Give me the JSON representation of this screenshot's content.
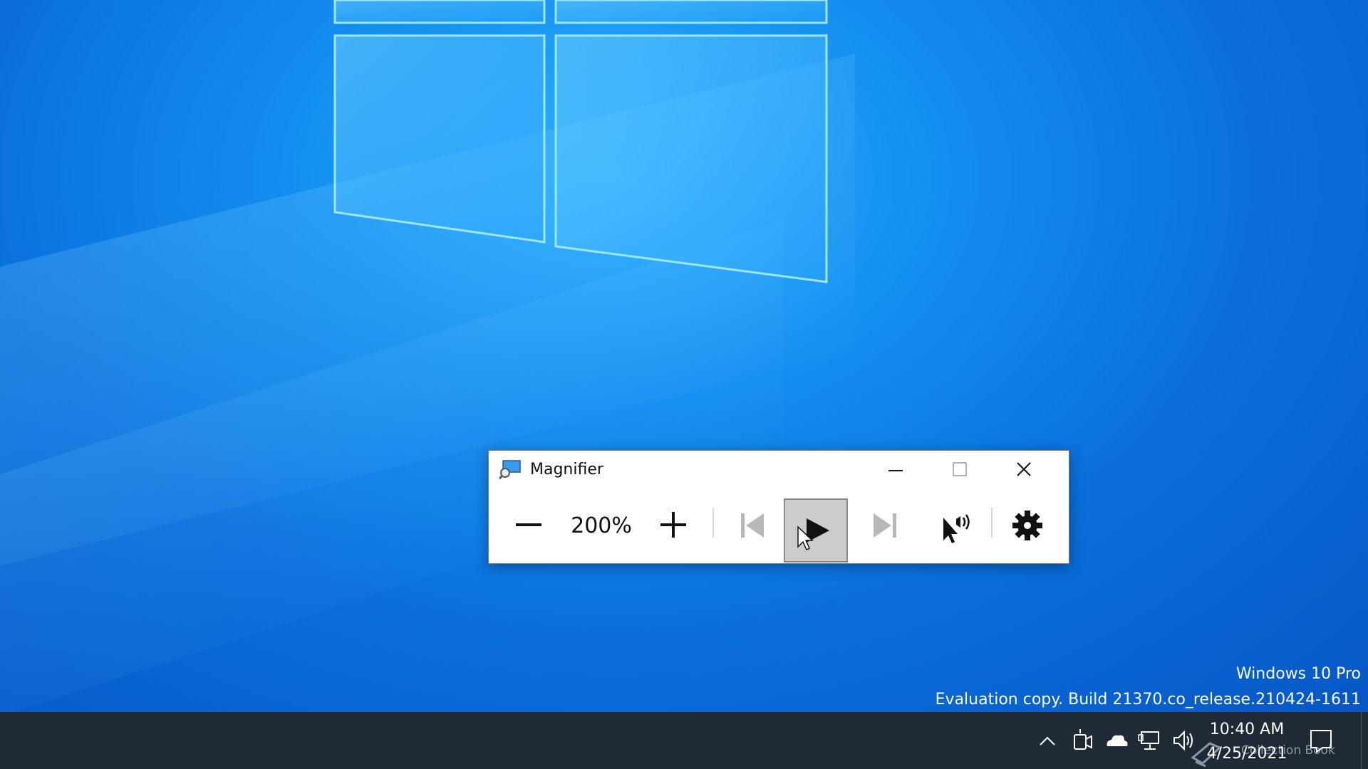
{
  "desktop": {
    "watermark_line1": "Windows 10 Pro",
    "watermark_line2": "Evaluation copy. Build 21370.co_release.210424-1611"
  },
  "magnifier": {
    "title": "Magnifier",
    "zoom_level": "200%",
    "title_buttons": {
      "minimize": "minimize-icon",
      "maximize": "maximize-icon",
      "close": "close-icon"
    },
    "toolbar_icons": [
      "zoom-out-icon",
      "zoom-in-icon",
      "previous-paragraph-icon",
      "play-icon",
      "next-paragraph-icon",
      "read-from-here-icon",
      "settings-icon"
    ],
    "pressed_button": "play"
  },
  "taskbar": {
    "time": "10:40 AM",
    "date": "4/25/2021",
    "overlay_label": "Collection Book",
    "tray_icons": [
      "chevron-up-icon",
      "meet-now-icon",
      "onedrive-cloud-icon",
      "network-icon",
      "volume-icon",
      "notification-icon"
    ],
    "background": "#1f2a36"
  },
  "colors": {
    "desktop_blue": "#0a6fdc",
    "play_pressed": "#cccccc"
  }
}
